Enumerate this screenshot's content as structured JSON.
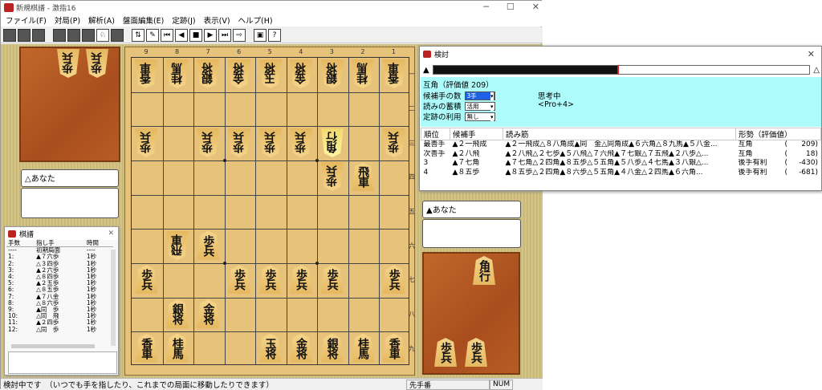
{
  "window": {
    "title": "新規棋譜 - 激指16"
  },
  "menu": [
    "ファイル(F)",
    "対局(P)",
    "解析(A)",
    "盤面編集(E)",
    "定跡(J)",
    "表示(V)",
    "ヘルプ(H)"
  ],
  "board": {
    "files": [
      "9",
      "8",
      "7",
      "6",
      "5",
      "4",
      "3",
      "2",
      "1"
    ],
    "ranks": [
      "一",
      "二",
      "三",
      "四",
      "五",
      "六",
      "七",
      "八",
      "九"
    ],
    "pieces": [
      {
        "f": 9,
        "r": 1,
        "k": "香車",
        "side": "gote"
      },
      {
        "f": 8,
        "r": 1,
        "k": "桂馬",
        "side": "gote"
      },
      {
        "f": 7,
        "r": 1,
        "k": "銀将",
        "side": "gote"
      },
      {
        "f": 6,
        "r": 1,
        "k": "金将",
        "side": "gote"
      },
      {
        "f": 5,
        "r": 1,
        "k": "玉将",
        "side": "gote"
      },
      {
        "f": 4,
        "r": 1,
        "k": "金将",
        "side": "gote"
      },
      {
        "f": 3,
        "r": 1,
        "k": "銀将",
        "side": "gote"
      },
      {
        "f": 2,
        "r": 1,
        "k": "桂馬",
        "side": "gote"
      },
      {
        "f": 1,
        "r": 1,
        "k": "香車",
        "side": "gote"
      },
      {
        "f": 9,
        "r": 3,
        "k": "歩兵",
        "side": "gote"
      },
      {
        "f": 7,
        "r": 3,
        "k": "歩兵",
        "side": "gote"
      },
      {
        "f": 6,
        "r": 3,
        "k": "歩兵",
        "side": "gote"
      },
      {
        "f": 5,
        "r": 3,
        "k": "歩兵",
        "side": "gote"
      },
      {
        "f": 4,
        "r": 3,
        "k": "歩兵",
        "side": "gote"
      },
      {
        "f": 3,
        "r": 3,
        "k": "角行",
        "side": "gote",
        "hl": true
      },
      {
        "f": 1,
        "r": 3,
        "k": "歩兵",
        "side": "gote"
      },
      {
        "f": 3,
        "r": 4,
        "k": "歩兵",
        "side": "gote"
      },
      {
        "f": 2,
        "r": 4,
        "k": "飛車",
        "side": "sente"
      },
      {
        "f": 8,
        "r": 6,
        "k": "飛車",
        "side": "gote"
      },
      {
        "f": 7,
        "r": 6,
        "k": "歩兵",
        "side": "sente"
      },
      {
        "f": 9,
        "r": 7,
        "k": "歩兵",
        "side": "sente"
      },
      {
        "f": 6,
        "r": 7,
        "k": "歩兵",
        "side": "sente"
      },
      {
        "f": 5,
        "r": 7,
        "k": "歩兵",
        "side": "sente"
      },
      {
        "f": 4,
        "r": 7,
        "k": "歩兵",
        "side": "sente"
      },
      {
        "f": 3,
        "r": 7,
        "k": "歩兵",
        "side": "sente"
      },
      {
        "f": 1,
        "r": 7,
        "k": "歩兵",
        "side": "sente"
      },
      {
        "f": 8,
        "r": 8,
        "k": "銀将",
        "side": "sente"
      },
      {
        "f": 7,
        "r": 8,
        "k": "金将",
        "side": "sente"
      },
      {
        "f": 9,
        "r": 9,
        "k": "香車",
        "side": "sente"
      },
      {
        "f": 8,
        "r": 9,
        "k": "桂馬",
        "side": "sente"
      },
      {
        "f": 5,
        "r": 9,
        "k": "玉将",
        "side": "sente"
      },
      {
        "f": 4,
        "r": 9,
        "k": "金将",
        "side": "sente"
      },
      {
        "f": 3,
        "r": 9,
        "k": "銀将",
        "side": "sente"
      },
      {
        "f": 2,
        "r": 9,
        "k": "桂馬",
        "side": "sente"
      },
      {
        "f": 1,
        "r": 9,
        "k": "香車",
        "side": "sente"
      }
    ]
  },
  "gote_hand": [
    "歩兵",
    "歩兵"
  ],
  "sente_hand": [
    "角行",
    "歩兵",
    "歩兵"
  ],
  "gote_player": "△あなた",
  "sente_player": "▲あなた",
  "kifu": {
    "title": "棋譜",
    "headers": [
      "手数",
      "指し手",
      "時間"
    ],
    "rows": [
      [
        "----",
        "初期局面",
        "----"
      ],
      [
        "1:",
        "▲７六歩",
        "1秒"
      ],
      [
        "2:",
        "△３四歩",
        "1秒"
      ],
      [
        "3:",
        "▲２六歩",
        "1秒"
      ],
      [
        "4:",
        "△８四歩",
        "1秒"
      ],
      [
        "5:",
        "▲２五歩",
        "1秒"
      ],
      [
        "6:",
        "△８五歩",
        "1秒"
      ],
      [
        "7:",
        "▲７八金",
        "1秒"
      ],
      [
        "8:",
        "△８六歩",
        "1秒"
      ],
      [
        "9:",
        "▲同　歩",
        "1秒"
      ],
      [
        "10:",
        "△同　飛",
        "1秒"
      ],
      [
        "11:",
        "▲２四歩",
        "1秒"
      ],
      [
        "12:",
        "△同　歩",
        "1秒"
      ]
    ]
  },
  "kento": {
    "title": "検討",
    "sente_mark": "▲",
    "gote_mark": "△",
    "eval_fraction": 0.49,
    "eval_text": "互角（評価値 209）",
    "cands_label": "候補手の数",
    "cands_value": "3手",
    "yomi_label": "読みの蓄積",
    "yomi_value": "活用",
    "joseki_label": "定跡の利用",
    "joseki_value": "無し",
    "thinking": "思考中",
    "engine": "<Pro+4>",
    "headers": [
      "順位",
      "候補手",
      "読み筋",
      "形勢（評価値）"
    ],
    "rows": [
      [
        "最善手",
        "▲２一飛成",
        "▲２一飛成△８八角成▲同　金△同角成▲６六角△８九馬▲５八金...",
        "互角",
        "(",
        209,
        ")"
      ],
      [
        "次善手",
        "▲２八飛",
        "▲２八飛△２七歩▲５八飛△７六飛▲７七銀△７五飛▲２八歩△...",
        "互角",
        "(",
        18,
        ")"
      ],
      [
        "3",
        "▲７七角",
        "▲７七角△２四角▲８五歩△５五角▲５八歩△４七馬▲３八銀△...",
        "後手有利",
        "(",
        -430,
        ")"
      ],
      [
        "4",
        "▲８五歩",
        "▲８五歩△２四角▲８六歩△５五角▲４八金△２四馬▲６六角...",
        "後手有利",
        "(",
        -681,
        ")"
      ]
    ]
  },
  "status": {
    "message": "検討中です　（いつでも手を指したり、これまでの局面に移動したりできます）",
    "turn": "先手番",
    "num": "NUM"
  }
}
